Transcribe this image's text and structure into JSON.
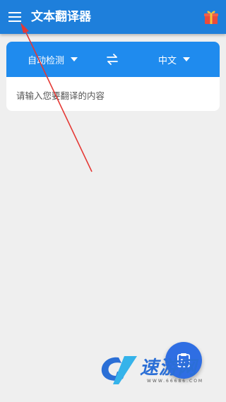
{
  "app": {
    "title": "文本翻译器"
  },
  "translator": {
    "source_language": "自动检测",
    "target_language": "中文",
    "input_placeholder": "请输入您要翻译的内容"
  },
  "watermark": {
    "brand": "速游网",
    "domain": "WWW.66686.COM"
  },
  "colors": {
    "app_bar": "#1e7fdb",
    "language_bar": "#1f8bee",
    "background": "#efefef",
    "fab": "#2f6ee3",
    "annotation_arrow": "#e53935"
  },
  "icons": {
    "menu": "menu-icon",
    "gift": "gift-icon",
    "swap": "swap-icon",
    "fab": "translate-image-icon"
  }
}
